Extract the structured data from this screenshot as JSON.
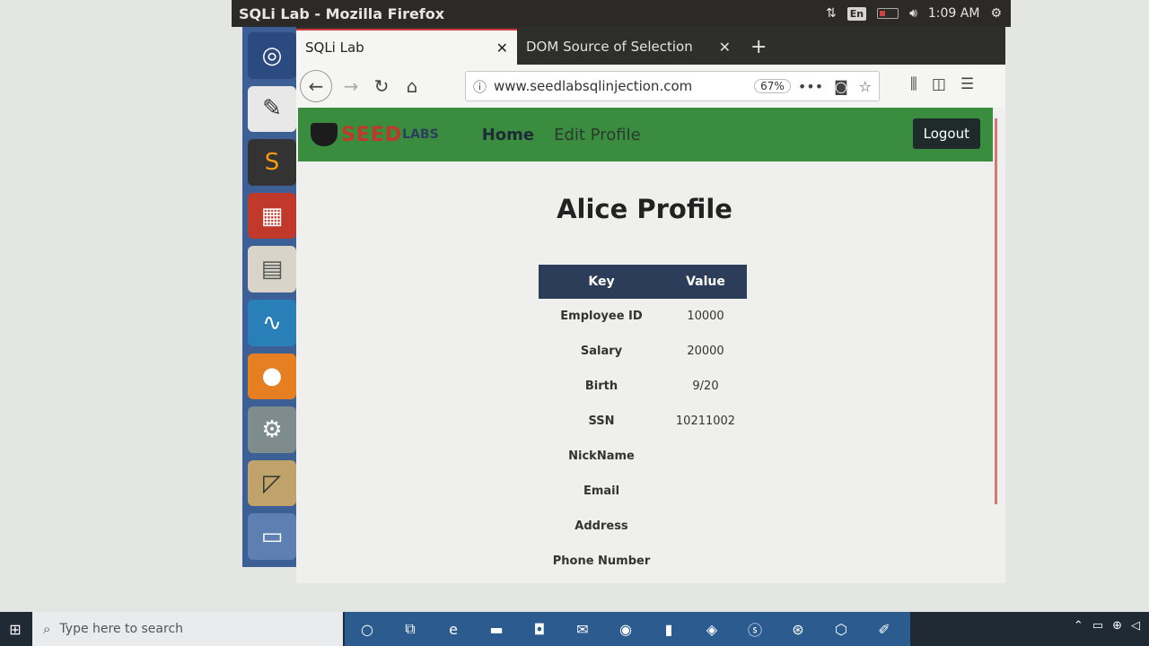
{
  "window": {
    "title": "SQLi Lab - Mozilla Firefox"
  },
  "topbar": {
    "lang": "En",
    "clock": "1:09 AM"
  },
  "tabs": [
    {
      "label": "SQLi Lab",
      "close": "✕"
    },
    {
      "label": "DOM Source of Selection",
      "close": "✕"
    }
  ],
  "newtab_label": "+",
  "urlbar": {
    "url": "www.seedlabsqlinjection.com",
    "zoom": "67%"
  },
  "site": {
    "logo_seed": "SEED",
    "logo_labs": "LABS",
    "nav": [
      "Home",
      "Edit Profile"
    ],
    "logout": "Logout"
  },
  "page": {
    "title": "Alice Profile",
    "headers": {
      "key": "Key",
      "value": "Value"
    },
    "rows": [
      {
        "key": "Employee ID",
        "value": "10000"
      },
      {
        "key": "Salary",
        "value": "20000"
      },
      {
        "key": "Birth",
        "value": "9/20"
      },
      {
        "key": "SSN",
        "value": "10211002"
      },
      {
        "key": "NickName",
        "value": ""
      },
      {
        "key": "Email",
        "value": ""
      },
      {
        "key": "Address",
        "value": ""
      },
      {
        "key": "Phone Number",
        "value": ""
      }
    ]
  },
  "taskbar": {
    "search_placeholder": "Type here to search"
  }
}
